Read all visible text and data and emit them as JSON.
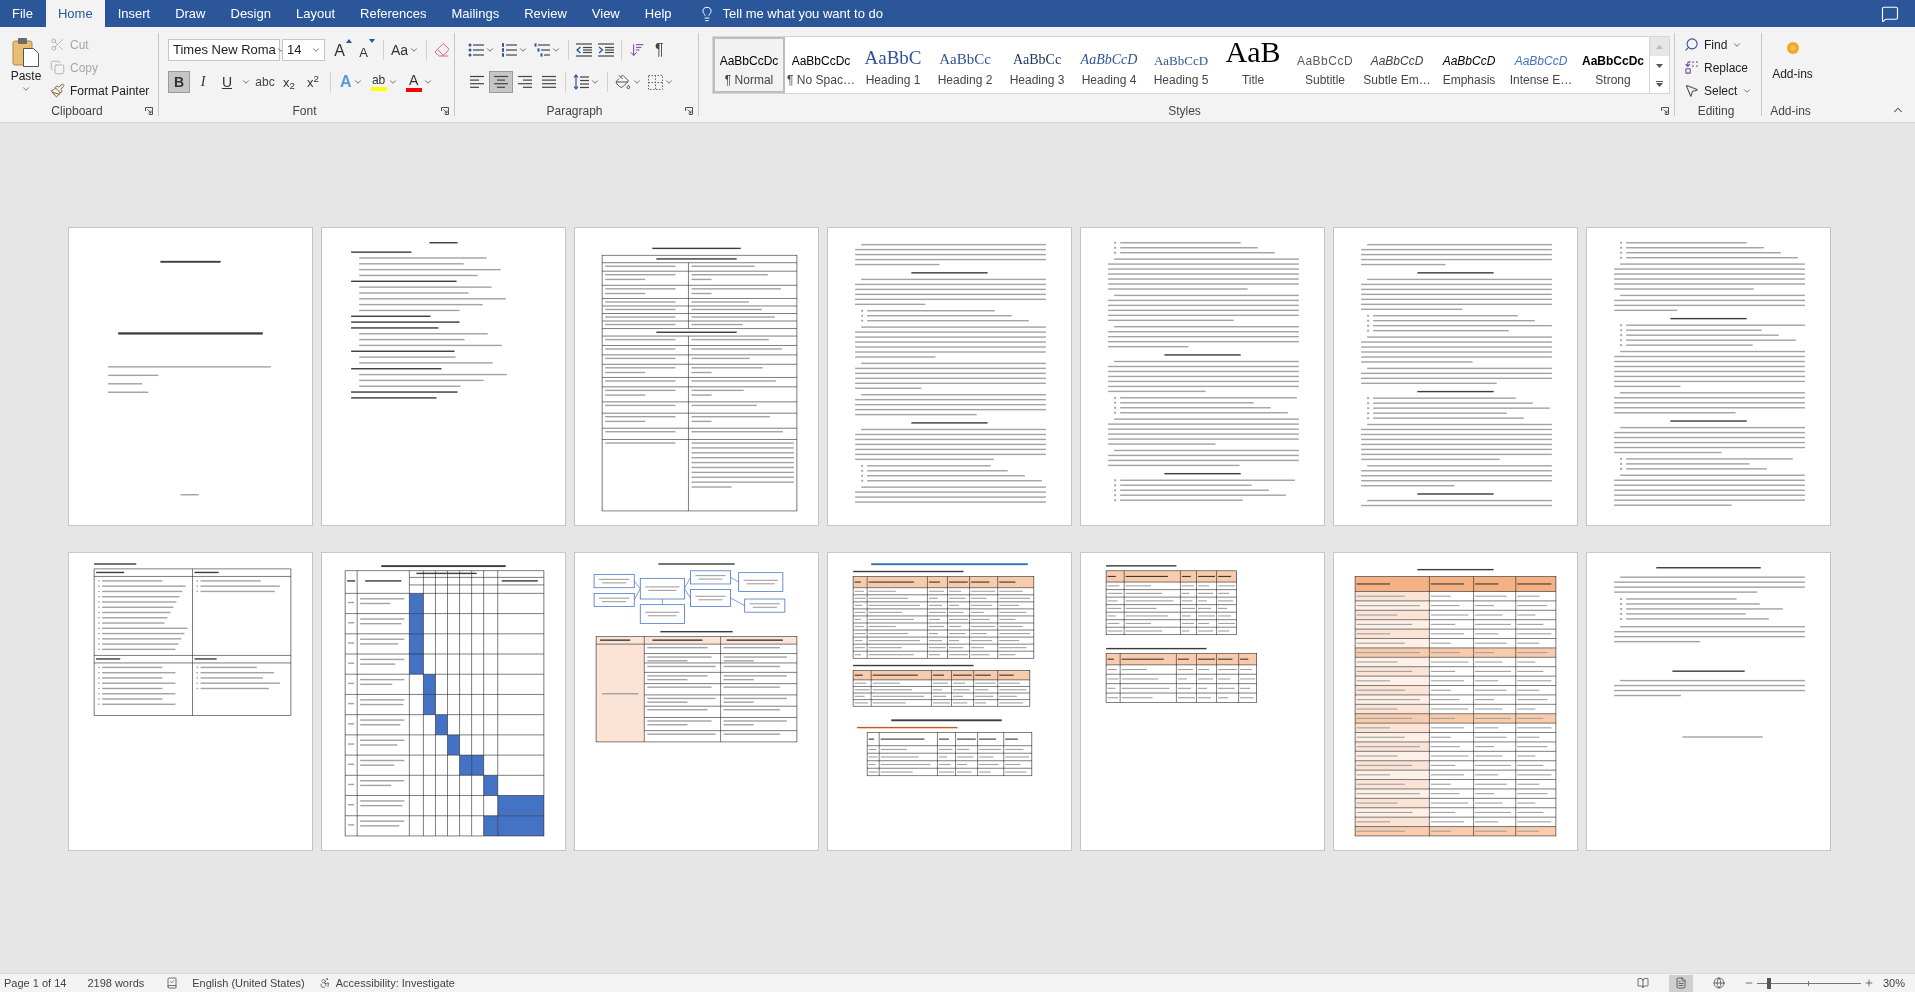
{
  "tabs": [
    {
      "label": "File",
      "selected": false
    },
    {
      "label": "Home",
      "selected": true
    },
    {
      "label": "Insert",
      "selected": false
    },
    {
      "label": "Draw",
      "selected": false
    },
    {
      "label": "Design",
      "selected": false
    },
    {
      "label": "Layout",
      "selected": false
    },
    {
      "label": "References",
      "selected": false
    },
    {
      "label": "Mailings",
      "selected": false
    },
    {
      "label": "Review",
      "selected": false
    },
    {
      "label": "View",
      "selected": false
    },
    {
      "label": "Help",
      "selected": false
    }
  ],
  "tell_me": {
    "placeholder": "Tell me what you want to do"
  },
  "clipboard": {
    "title": "Clipboard",
    "paste": "Paste",
    "actions": [
      {
        "kind": "cut",
        "label": "Cut",
        "disabled": true
      },
      {
        "kind": "copy",
        "label": "Copy",
        "disabled": true
      },
      {
        "kind": "painter",
        "label": "Format Painter",
        "disabled": false
      }
    ]
  },
  "font": {
    "title": "Font",
    "name": "Times New Roma",
    "size": "14",
    "size_tools": [
      {
        "kind": "grow",
        "label": "A"
      },
      {
        "kind": "shrink",
        "label": "A"
      }
    ],
    "case": "Aa",
    "formats": [
      {
        "kind": "bold",
        "label": "B",
        "selected": true
      },
      {
        "kind": "italic",
        "label": "I",
        "selected": false
      },
      {
        "kind": "underline",
        "label": "U",
        "selected": false
      },
      {
        "kind": "strike",
        "label": "abc",
        "selected": false
      },
      {
        "kind": "sub",
        "label": "x$_{2}$",
        "selected": false
      },
      {
        "kind": "sup",
        "label": "x$^{2}$",
        "selected": false
      }
    ],
    "colors": [
      {
        "kind": "effects",
        "label": "A"
      },
      {
        "kind": "highlight",
        "label": "ab",
        "color": "#ffff00"
      },
      {
        "kind": "font_color",
        "label": "A",
        "color": "#ff0000"
      }
    ]
  },
  "paragraph": {
    "title": "Paragraph",
    "pilcrow": "¶",
    "alignments": [
      {
        "kind": "left",
        "selected": false
      },
      {
        "kind": "center",
        "selected": true
      },
      {
        "kind": "right",
        "selected": false
      },
      {
        "kind": "justify",
        "selected": false
      }
    ]
  },
  "styles": {
    "title": "Styles",
    "items": [
      {
        "kind": "normal",
        "preview": "AaBbCcDc",
        "label": "¶ Normal",
        "selected": true
      },
      {
        "kind": "no_spacing",
        "preview": "AaBbCcDc",
        "label": "¶ No Spac…",
        "selected": false
      },
      {
        "kind": "heading1",
        "preview": "AaBbC",
        "label": "Heading 1",
        "selected": false
      },
      {
        "kind": "heading2",
        "preview": "AaBbCc",
        "label": "Heading 2",
        "selected": false
      },
      {
        "kind": "heading3",
        "preview": "AaBbCc",
        "label": "Heading 3",
        "selected": false
      },
      {
        "kind": "heading4",
        "preview": "AaBbCcD",
        "label": "Heading 4",
        "selected": false
      },
      {
        "kind": "heading5",
        "preview": "AaBbCcD",
        "label": "Heading 5",
        "selected": false
      },
      {
        "kind": "title",
        "preview": "AaB",
        "label": "Title",
        "selected": false
      },
      {
        "kind": "subtitle",
        "preview": "AaBbCcD",
        "label": "Subtitle",
        "selected": false
      },
      {
        "kind": "subtle_emphasis",
        "preview": "AaBbCcD",
        "label": "Subtle Em…",
        "selected": false
      },
      {
        "kind": "emphasis",
        "preview": "AaBbCcD",
        "label": "Emphasis",
        "selected": false
      },
      {
        "kind": "intense_emphasis",
        "preview": "AaBbCcD",
        "label": "Intense E…",
        "selected": false
      },
      {
        "kind": "strong",
        "preview": "AaBbCcDc",
        "label": "Strong",
        "selected": false
      }
    ]
  },
  "editing": {
    "title": "Editing",
    "actions": [
      {
        "kind": "find",
        "label": "Find"
      },
      {
        "kind": "replace",
        "label": "Replace"
      },
      {
        "kind": "select",
        "label": "Select"
      }
    ]
  },
  "addins": {
    "title": "Add-ins",
    "label": "Add-ins"
  },
  "pages": [
    {
      "kind": "cover"
    },
    {
      "kind": "contents"
    },
    {
      "kind": "form"
    },
    {
      "kind": "text"
    },
    {
      "kind": "text"
    },
    {
      "kind": "text"
    },
    {
      "kind": "text"
    },
    {
      "kind": "grid"
    },
    {
      "kind": "gantt"
    },
    {
      "kind": "diagram"
    },
    {
      "kind": "table"
    },
    {
      "kind": "table"
    },
    {
      "kind": "finance"
    },
    {
      "kind": "closing"
    }
  ],
  "status_bar": {
    "page": "Page 1 of 14",
    "words": "2198 words",
    "language": "English (United States)",
    "accessibility": "Accessibility: Investigate",
    "views": [
      {
        "kind": "read",
        "selected": false
      },
      {
        "kind": "print",
        "selected": true
      },
      {
        "kind": "web",
        "selected": false
      }
    ],
    "zoom": {
      "level": 0.12,
      "reading": "30%"
    }
  }
}
